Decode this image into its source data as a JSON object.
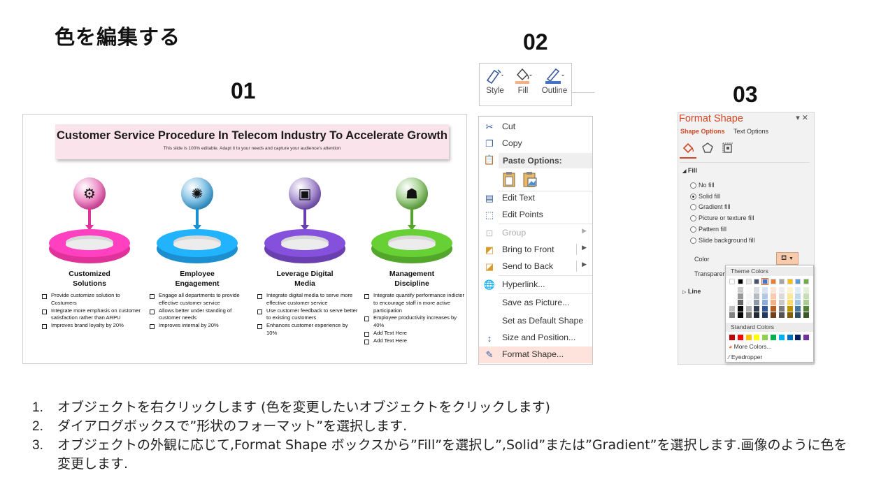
{
  "page": {
    "title": "色を編集する"
  },
  "steps": {
    "n1": "01",
    "n2": "02",
    "n3": "03"
  },
  "slide": {
    "title": "Customer Service Procedure In Telecom Industry To Accelerate Growth",
    "subtitle": "This slide is 100% editable. Adapt it to your needs and capture your audience's attention",
    "stages": [
      {
        "title_1": "Customized",
        "title_2": "Solutions",
        "icon": "gear-head-icon",
        "color": "#e0339a",
        "bullets": [
          "Provide customize solution to Costumers",
          "Integrate more emphasis on customer satisfaction rather than ARPU",
          "Improves brand loyalty by 20%"
        ]
      },
      {
        "title_1": "Employee",
        "title_2": "Engagement",
        "icon": "network-gear-icon",
        "color": "#1b8fd0",
        "bullets": [
          "Engage all departments to provide effective customer service",
          "Allows better under standing of customer needs",
          "Improves internal by 20%"
        ]
      },
      {
        "title_1": "Leverage Digital",
        "title_2": "Media",
        "icon": "digital-screen-icon",
        "color": "#6a40b0",
        "bullets": [
          "Integrate digital media to serve more effective customer service",
          "Use customer feedback to serve better to existing customers",
          "Enhances customer experience by 10%"
        ]
      },
      {
        "title_1": "Management",
        "title_2": "Discipline",
        "icon": "team-icon",
        "color": "#52a62a",
        "bullets": [
          "Integrate quantify performance indicter to encourage staff in more active participation",
          "Employee productivity increases by 40%",
          "Add Text Here",
          "Add Text Here"
        ]
      }
    ]
  },
  "mini_toolbar": {
    "style": "Style",
    "fill": "Fill",
    "outline": "Outline"
  },
  "context_menu": {
    "cut": "Cut",
    "copy": "Copy",
    "paste_options": "Paste Options:",
    "edit_text": "Edit Text",
    "edit_points": "Edit Points",
    "group": "Group",
    "bring_to_front": "Bring to Front",
    "send_to_back": "Send to Back",
    "hyperlink": "Hyperlink...",
    "save_as_picture": "Save as Picture...",
    "set_default_shape": "Set as Default Shape",
    "size_position": "Size and Position...",
    "format_shape": "Format Shape..."
  },
  "format_pane": {
    "title": "Format Shape",
    "tab_shape": "Shape Options",
    "tab_text": "Text Options",
    "section_fill": "Fill",
    "section_line": "Line",
    "no_fill": "No fill",
    "solid_fill": "Solid fill",
    "gradient_fill": "Gradient fill",
    "picture_fill": "Picture or texture fill",
    "pattern_fill": "Pattern fill",
    "background_fill": "Slide background fill",
    "selected_fill": "Solid fill",
    "color_label": "Color",
    "transparency_label": "Transparenc"
  },
  "color_popup": {
    "theme_colors": "Theme Colors",
    "standard_colors": "Standard Colors",
    "more_colors": "More Colors...",
    "eyedropper": "Eyedropper",
    "theme_top": [
      "#ffffff",
      "#000000",
      "#e7e6e6",
      "#44546a",
      "#4472c4",
      "#ed7d31",
      "#a5a5a5",
      "#ffc000",
      "#5b9bd5",
      "#70ad47"
    ],
    "standard": [
      "#c00000",
      "#ff0000",
      "#ffc000",
      "#ffff00",
      "#92d050",
      "#00b050",
      "#00b0f0",
      "#0070c0",
      "#002060",
      "#7030a0"
    ]
  },
  "instructions": [
    {
      "num": "1.",
      "text": "オブジェクトを右クリックします (色を変更したいオブジェクトをクリックします)"
    },
    {
      "num": "2.",
      "text": "ダイアログボックスで”形状のフォーマット”を選択します."
    },
    {
      "num": "3.",
      "text": "オブジェクトの外観に応じて,Format Shape ボックスから”Fill”を選択し”,Solid”または”Gradient”を選択します.画像のように色を変更します."
    }
  ]
}
